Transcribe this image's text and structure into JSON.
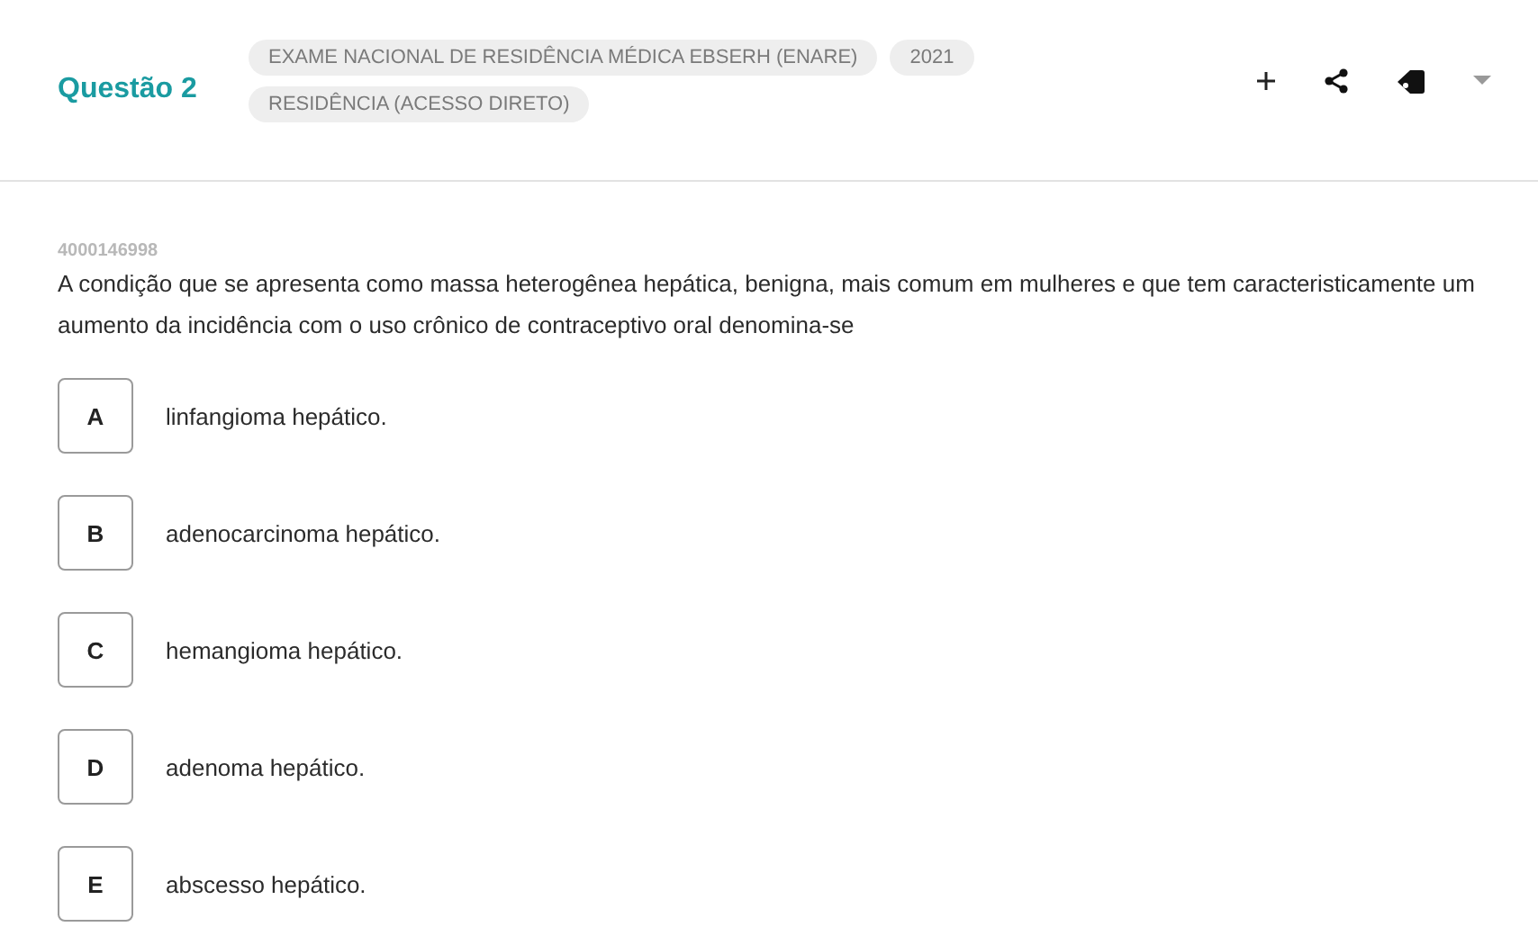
{
  "header": {
    "title": "Questão 2",
    "tags": [
      {
        "label": "EXAME NACIONAL DE RESIDÊNCIA MÉDICA EBSERH (ENARE)"
      },
      {
        "label": "2021"
      },
      {
        "label": "RESIDÊNCIA (ACESSO DIRETO)"
      }
    ]
  },
  "question": {
    "id": "4000146998",
    "text": "A condição que se apresenta como massa heterogênea hepática, benigna, mais comum em mulheres e que tem caracteristicamente um aumento da incidência com o uso crônico de contraceptivo oral denomina-se"
  },
  "options": [
    {
      "letter": "A",
      "text": "linfangioma hepático.",
      "selected": false
    },
    {
      "letter": "B",
      "text": "adenocarcinoma hepático.",
      "selected": false
    },
    {
      "letter": "C",
      "text": "hemangioma hepático.",
      "selected": false
    },
    {
      "letter": "D",
      "text": "adenoma hepático.",
      "selected": false
    },
    {
      "letter": "E",
      "text": "abscesso hepático.",
      "selected": false
    }
  ]
}
